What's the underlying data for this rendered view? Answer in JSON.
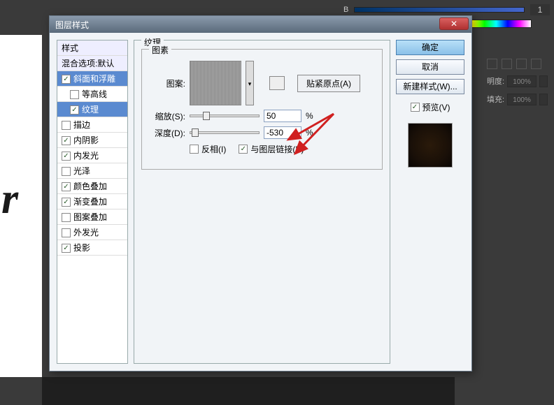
{
  "top": {
    "b_label": "B",
    "b_value": "1"
  },
  "right_panel": {
    "opacity_label": "明度:",
    "opacity_value": "100%",
    "fill_label": "填充:",
    "fill_value": "100%"
  },
  "dialog": {
    "title": "图层样式",
    "styles": {
      "style_header": "样式",
      "blend_header": "混合选项:默认",
      "bevel": "斜面和浮雕",
      "contour": "等高线",
      "texture": "纹理",
      "stroke": "描边",
      "inner_shadow": "内阴影",
      "inner_glow": "内发光",
      "satin": "光泽",
      "color_overlay": "颜色叠加",
      "gradient_overlay": "渐变叠加",
      "pattern_overlay": "图案叠加",
      "outer_glow": "外发光",
      "drop_shadow": "投影"
    },
    "texture_panel": {
      "section_title": "纹理",
      "pattern_group": "图素",
      "pattern_label": "图案:",
      "snap_origin": "贴紧原点(A)",
      "scale_label": "缩放(S):",
      "scale_value": "50",
      "depth_label": "深度(D):",
      "depth_value": "-530",
      "percent": "%",
      "invert": "反相(I)",
      "link_layer": "与图层链接(K)"
    },
    "buttons": {
      "ok": "确定",
      "cancel": "取消",
      "new_style": "新建样式(W)...",
      "preview": "预览(V)"
    }
  }
}
